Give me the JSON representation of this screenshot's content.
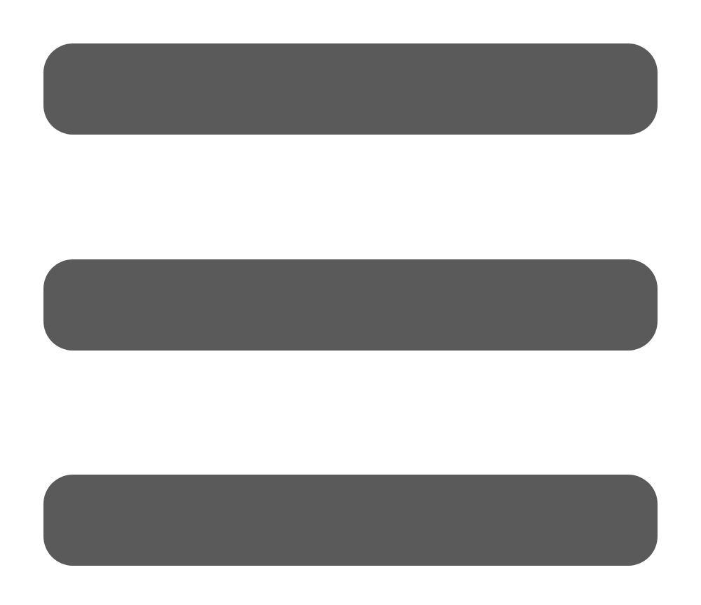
{
  "menu_button": {
    "icon": "hamburger-menu-icon",
    "bar_color": "#5a5a5a",
    "bars": 3
  }
}
